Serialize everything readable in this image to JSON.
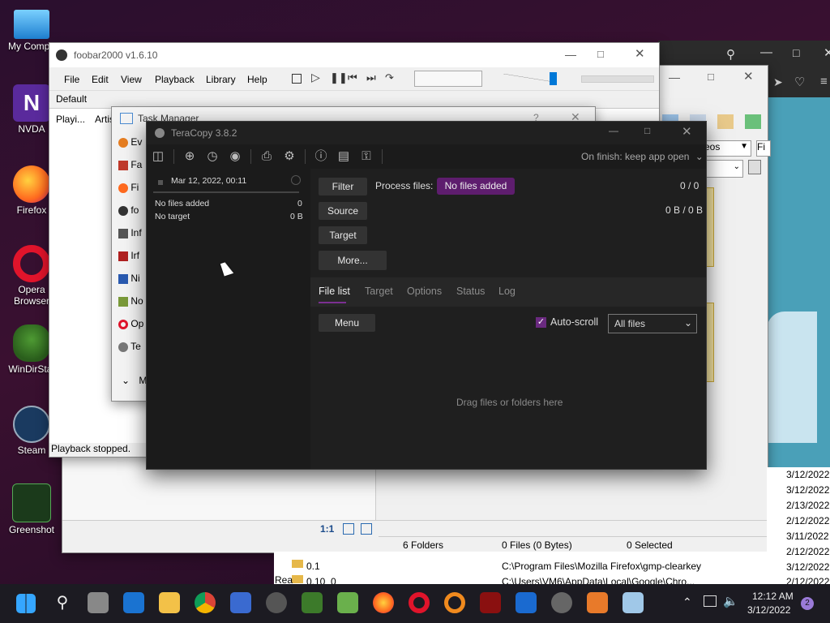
{
  "desktop": {
    "icons": [
      {
        "label": "My Compu",
        "color": "#3ba0e6"
      },
      {
        "label": "NVDA",
        "color": "#5a2a9c"
      },
      {
        "label": "Firefox",
        "color": "#ff6a1f"
      },
      {
        "label": "Opera Browser",
        "color": "#e0142b"
      },
      {
        "label": "WinDirStat",
        "color": "#3c7a2a"
      },
      {
        "label": "Steam",
        "color": "#1a3a60"
      },
      {
        "label": "Greenshot",
        "color": "#2c6a2c"
      }
    ]
  },
  "foobar": {
    "title": "foobar2000 v1.6.10",
    "menu": [
      "File",
      "Edit",
      "View",
      "Playback",
      "Library",
      "Help"
    ],
    "tab_default": "Default",
    "col1": "Playi...",
    "col2": "Artis",
    "status": "Playback stopped."
  },
  "taskmanager": {
    "title": "Task Manager",
    "items": [
      "Ev",
      "Fa",
      "Fi",
      "fo",
      "Inf",
      "Irf",
      "Ni",
      "No",
      "Op",
      "Te"
    ],
    "more": "M"
  },
  "explorer": {
    "videos_select": "eos",
    "fi_label": "Fi",
    "status_ratio": "1:1",
    "status_folders": "6 Folders",
    "status_files": "0 Files (0 Bytes)",
    "status_selected": "0 Selected",
    "rows": [
      {
        "name": "0.1",
        "path": "C:\\Program Files\\Mozilla Firefox\\gmp-clearkey"
      },
      {
        "name": "0.10_0",
        "path": "C:\\Users\\VM6\\AppData\\Local\\Google\\Chro..."
      }
    ],
    "rea": "Rea",
    "dates": [
      "3/12/2022",
      "3/12/2022",
      "2/13/2022",
      "2/12/2022",
      "3/11/2022",
      "2/12/2022",
      "3/12/2022",
      "2/12/2022"
    ]
  },
  "teracopy": {
    "title": "TeraCopy 3.8.2",
    "on_finish": "On finish: keep app open",
    "job_date": "Mar 12, 2022, 00:11",
    "no_files": "No files added",
    "no_files_count": "0",
    "no_target": "No target",
    "no_target_size": "0 B",
    "filter": "Filter",
    "source": "Source",
    "target": "Target",
    "more": "More...",
    "process_files": "Process files:",
    "process_badge": "No files added",
    "count": "0 / 0",
    "bytes": "0 B / 0 B",
    "tabs": [
      "File list",
      "Target",
      "Options",
      "Status",
      "Log"
    ],
    "menu_btn": "Menu",
    "autoscroll": "Auto-scroll",
    "filter_select": "All files",
    "drop_hint": "Drag files or folders here",
    "accent": "#7b2f91"
  },
  "taskbar": {
    "time": "12:12 AM",
    "date": "3/12/2022",
    "notif": "2"
  }
}
